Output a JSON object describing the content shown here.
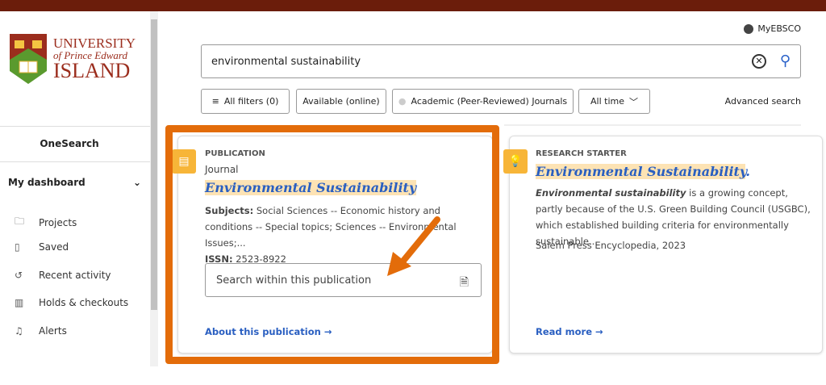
{
  "header": {
    "account": "MyEBSCO"
  },
  "logo": {
    "line1": "UNIVERSITY",
    "line2": "of Prince Edward",
    "line3": "ISLAND"
  },
  "sidebar": {
    "onesearch": "OneSearch",
    "dashboard": "My dashboard",
    "items": [
      {
        "label": "Projects",
        "icon": "folder-icon"
      },
      {
        "label": "Saved",
        "icon": "bookmark-icon"
      },
      {
        "label": "Recent activity",
        "icon": "history-icon"
      },
      {
        "label": "Holds & checkouts",
        "icon": "books-icon"
      },
      {
        "label": "Alerts",
        "icon": "bell-icon"
      }
    ]
  },
  "search": {
    "value": "environmental sustainability"
  },
  "filters": {
    "all": "All filters (0)",
    "available": "Available (online)",
    "academic": "Academic (Peer-Reviewed) Journals",
    "time": "All time",
    "advanced": "Advanced search"
  },
  "cards": [
    {
      "kind": "PUBLICATION",
      "type": "Journal",
      "title": "Environmental Sustainability",
      "subjects_label": "Subjects:",
      "subjects": "Social Sciences -- Economic history and conditions -- Special topics; Sciences -- Environmental Issues;...",
      "issn_label": "ISSN:",
      "issn": "2523-8922",
      "within_placeholder": "Search within this publication",
      "link": "About this publication"
    },
    {
      "kind": "RESEARCH STARTER",
      "title": "Environmental Sustainability",
      "title_suffix": ".",
      "lead": "Environmental sustainability",
      "text": " is a growing concept, partly because of the U.S. Green Building Council (USGBC), which established building criteria for environmentally sustainable...",
      "source": "Salem Press Encyclopedia, 2023",
      "link": "Read more"
    }
  ],
  "colors": {
    "topbar": "#6b1d0b",
    "highlight": "#e36c0a",
    "link": "#2a5fc1",
    "flag": "#f7b538"
  }
}
